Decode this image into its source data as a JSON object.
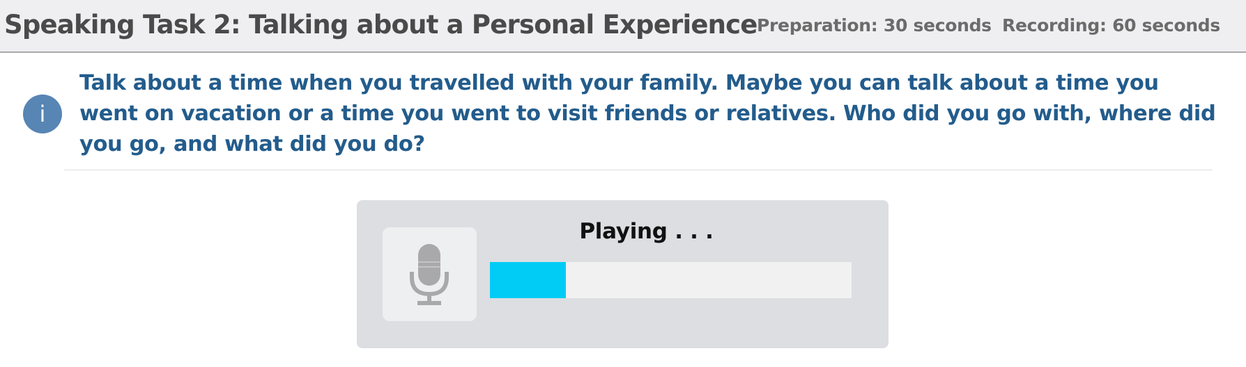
{
  "header": {
    "title": "Speaking Task 2: Talking about a Personal Experience",
    "preparation": "Preparation: 30 seconds",
    "recording": "Recording: 60 seconds"
  },
  "prompt": {
    "icon": "info-icon",
    "icon_glyph": "i",
    "text": "Talk about a time when you travelled with your family. Maybe you can talk about a time you went on vacation or a time you went to visit friends or relatives. Who did you go with, where did you go, and what did you do?"
  },
  "player": {
    "icon": "microphone-icon",
    "status": "Playing . . .",
    "progress_fraction": 0.21,
    "progress_color": "#00ccf5"
  },
  "colors": {
    "prompt_text": "#235c8c",
    "info_icon_bg": "#5785b4",
    "header_bg": "#efeff1",
    "player_bg": "#dcdee2"
  }
}
